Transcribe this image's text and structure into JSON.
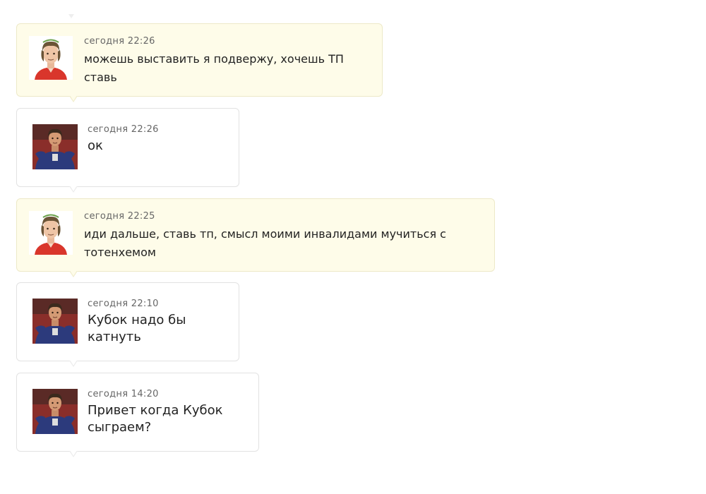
{
  "messages": [
    {
      "time": "сегодня 22:26",
      "lines": [
        "можешь выставить я подвержу, хочешь ТП",
        "ставь"
      ],
      "avatar": "player-red-shirt-avatar"
    },
    {
      "time": "сегодня 22:26",
      "lines": [
        "ок"
      ],
      "avatar": "player-blue-shirt-avatar"
    },
    {
      "time": "сегодня 22:25",
      "lines": [
        "иди дальше, ставь тп, смысл моими инвалидами мучиться с",
        "тотенхемом"
      ],
      "avatar": "player-red-shirt-avatar"
    },
    {
      "time": "сегодня 22:10",
      "lines": [
        "Кубок надо бы",
        "катнуть"
      ],
      "avatar": "player-blue-shirt-avatar"
    },
    {
      "time": "сегодня 14:20",
      "lines": [
        "Привет когда Кубок",
        "сыграем?"
      ],
      "avatar": "player-blue-shirt-avatar"
    }
  ],
  "colors": {
    "incoming_bg": "#fefce9",
    "outgoing_bg": "#ffffff",
    "border": "#e2e2e2"
  }
}
